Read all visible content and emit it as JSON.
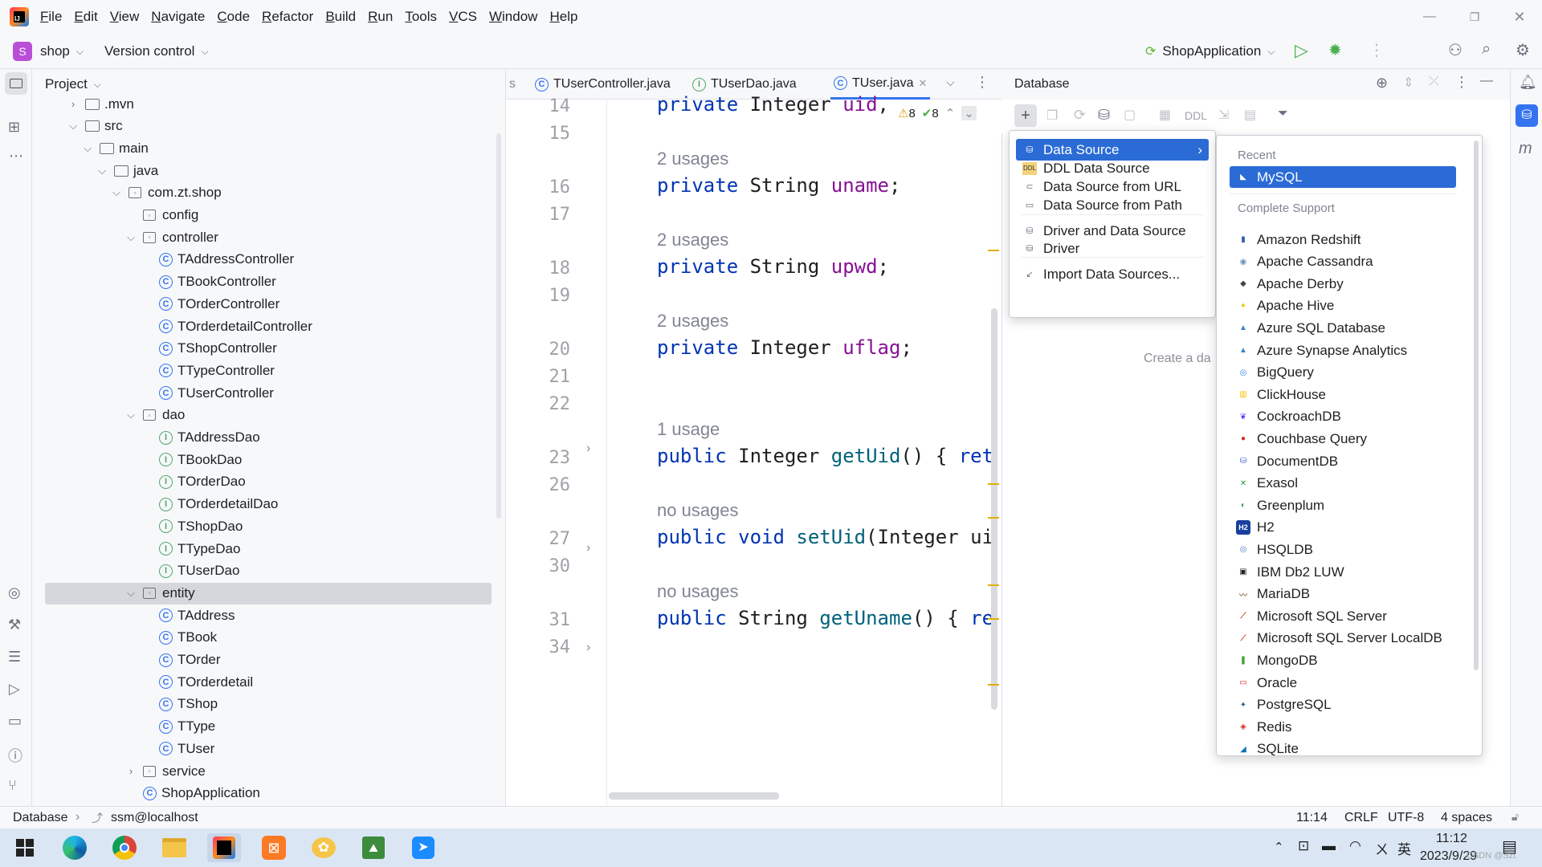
{
  "menubar": {
    "items": [
      "File",
      "Edit",
      "View",
      "Navigate",
      "Code",
      "Refactor",
      "Build",
      "Run",
      "Tools",
      "VCS",
      "Window",
      "Help"
    ]
  },
  "toolbar": {
    "project_badge": "S",
    "project_name": "shop",
    "vcs_label": "Version control",
    "run_config": "ShopApplication"
  },
  "project": {
    "title": "Project",
    "tree": [
      {
        "label": ".mvn",
        "kind": "folder",
        "depth": 1,
        "arrow": "right"
      },
      {
        "label": "src",
        "kind": "folder",
        "depth": 1,
        "arrow": "down"
      },
      {
        "label": "main",
        "kind": "folder",
        "depth": 2,
        "arrow": "down"
      },
      {
        "label": "java",
        "kind": "folder",
        "depth": 3,
        "arrow": "down"
      },
      {
        "label": "com.zt.shop",
        "kind": "package",
        "depth": 4,
        "arrow": "down"
      },
      {
        "label": "config",
        "kind": "package",
        "depth": 5,
        "arrow": ""
      },
      {
        "label": "controller",
        "kind": "package",
        "depth": 5,
        "arrow": "down"
      },
      {
        "label": "TAddressController",
        "kind": "class",
        "depth": 6,
        "arrow": ""
      },
      {
        "label": "TBookController",
        "kind": "class",
        "depth": 6,
        "arrow": ""
      },
      {
        "label": "TOrderController",
        "kind": "class",
        "depth": 6,
        "arrow": ""
      },
      {
        "label": "TOrderdetailController",
        "kind": "class",
        "depth": 6,
        "arrow": ""
      },
      {
        "label": "TShopController",
        "kind": "class",
        "depth": 6,
        "arrow": ""
      },
      {
        "label": "TTypeController",
        "kind": "class",
        "depth": 6,
        "arrow": ""
      },
      {
        "label": "TUserController",
        "kind": "class",
        "depth": 6,
        "arrow": ""
      },
      {
        "label": "dao",
        "kind": "package",
        "depth": 5,
        "arrow": "down"
      },
      {
        "label": "TAddressDao",
        "kind": "interface",
        "depth": 6,
        "arrow": ""
      },
      {
        "label": "TBookDao",
        "kind": "interface",
        "depth": 6,
        "arrow": ""
      },
      {
        "label": "TOrderDao",
        "kind": "interface",
        "depth": 6,
        "arrow": ""
      },
      {
        "label": "TOrderdetailDao",
        "kind": "interface",
        "depth": 6,
        "arrow": ""
      },
      {
        "label": "TShopDao",
        "kind": "interface",
        "depth": 6,
        "arrow": ""
      },
      {
        "label": "TTypeDao",
        "kind": "interface",
        "depth": 6,
        "arrow": ""
      },
      {
        "label": "TUserDao",
        "kind": "interface",
        "depth": 6,
        "arrow": ""
      },
      {
        "label": "entity",
        "kind": "package",
        "depth": 5,
        "arrow": "down",
        "selected": true
      },
      {
        "label": "TAddress",
        "kind": "class",
        "depth": 6,
        "arrow": ""
      },
      {
        "label": "TBook",
        "kind": "class",
        "depth": 6,
        "arrow": ""
      },
      {
        "label": "TOrder",
        "kind": "class",
        "depth": 6,
        "arrow": ""
      },
      {
        "label": "TOrderdetail",
        "kind": "class",
        "depth": 6,
        "arrow": ""
      },
      {
        "label": "TShop",
        "kind": "class",
        "depth": 6,
        "arrow": ""
      },
      {
        "label": "TType",
        "kind": "class",
        "depth": 6,
        "arrow": ""
      },
      {
        "label": "TUser",
        "kind": "class",
        "depth": 6,
        "arrow": ""
      },
      {
        "label": "service",
        "kind": "package",
        "depth": 5,
        "arrow": "right"
      },
      {
        "label": "ShopApplication",
        "kind": "app",
        "depth": 5,
        "arrow": ""
      }
    ]
  },
  "editor": {
    "tab_partial": "s",
    "tabs": [
      "TUserController.java",
      "TUserDao.java",
      "TUser.java"
    ],
    "active_tab": "TUser.java",
    "warnings": "8",
    "checks": "8",
    "lines": [
      {
        "num": "14",
        "usage": "",
        "tokens": [
          [
            "kw",
            "private "
          ],
          [
            "",
            "Integer "
          ],
          [
            "fld",
            "uid"
          ],
          [
            "",
            ","
          ]
        ]
      },
      {
        "num": "15",
        "usage": "",
        "tokens": []
      },
      {
        "num": "16",
        "usage": "2 usages",
        "tokens": [
          [
            "kw",
            "private "
          ],
          [
            "",
            "String "
          ],
          [
            "fld",
            "uname"
          ],
          [
            "",
            ";"
          ]
        ]
      },
      {
        "num": "17",
        "usage": "",
        "tokens": []
      },
      {
        "num": "18",
        "usage": "2 usages",
        "tokens": [
          [
            "kw",
            "private "
          ],
          [
            "",
            "String "
          ],
          [
            "fld",
            "upwd"
          ],
          [
            "",
            ";"
          ]
        ]
      },
      {
        "num": "19",
        "usage": "",
        "tokens": []
      },
      {
        "num": "20",
        "usage": "2 usages",
        "tokens": [
          [
            "kw",
            "private "
          ],
          [
            "",
            "Integer "
          ],
          [
            "fld",
            "uflag"
          ],
          [
            "",
            ";"
          ]
        ]
      },
      {
        "num": "21",
        "usage": "",
        "tokens": []
      },
      {
        "num": "22",
        "usage": "",
        "tokens": []
      },
      {
        "num": "23",
        "usage": "1 usage",
        "tokens": [
          [
            "kw",
            "public "
          ],
          [
            "",
            "Integer "
          ],
          [
            "mth",
            "getUid"
          ],
          [
            "",
            "() { "
          ],
          [
            "kw",
            "ret"
          ]
        ]
      },
      {
        "num": "26",
        "usage": "",
        "tokens": []
      },
      {
        "num": "27",
        "usage": "no usages",
        "tokens": [
          [
            "kw",
            "public void "
          ],
          [
            "mth",
            "setUid"
          ],
          [
            "",
            "(Integer ui"
          ]
        ]
      },
      {
        "num": "30",
        "usage": "",
        "tokens": []
      },
      {
        "num": "31",
        "usage": "no usages",
        "tokens": [
          [
            "kw",
            "public "
          ],
          [
            "",
            "String "
          ],
          [
            "mth",
            "getUname"
          ],
          [
            "",
            "() { "
          ],
          [
            "kw",
            "re"
          ]
        ]
      },
      {
        "num": "34",
        "usage": "",
        "tokens": []
      }
    ]
  },
  "database": {
    "title": "Database",
    "toolbar_ddl": "DDL",
    "empty_hint": "Create a da",
    "new_menu": [
      {
        "label": "Data Source",
        "icon": "datasource-icon",
        "selected": true,
        "submenu": true
      },
      {
        "label": "DDL Data Source",
        "icon": "ddl-icon"
      },
      {
        "label": "Data Source from URL",
        "icon": "url-icon"
      },
      {
        "label": "Data Source from Path",
        "icon": "folder-icon"
      },
      {
        "label": "Driver and Data Source",
        "icon": "driver-icon",
        "separator_before": true
      },
      {
        "label": "Driver",
        "icon": "driver-icon"
      },
      {
        "label": "Import Data Sources...",
        "icon": "import-icon",
        "separator_before": true
      }
    ],
    "submenu": {
      "recent_header": "Recent",
      "recent": [
        {
          "label": "MySQL",
          "icon": "mysql-icon",
          "color": "#ffffff"
        }
      ],
      "complete_header": "Complete Support",
      "items": [
        {
          "label": "Amazon Redshift",
          "color": "#2f5fa8"
        },
        {
          "label": "Apache Cassandra",
          "color": "#6b8fbf"
        },
        {
          "label": "Apache Derby",
          "color": "#444444"
        },
        {
          "label": "Apache Hive",
          "color": "#e6c600"
        },
        {
          "label": "Azure SQL Database",
          "color": "#3b82c4"
        },
        {
          "label": "Azure Synapse Analytics",
          "color": "#3b82c4"
        },
        {
          "label": "BigQuery",
          "color": "#4285f4"
        },
        {
          "label": "ClickHouse",
          "color": "#f5c400"
        },
        {
          "label": "CockroachDB",
          "color": "#6933ff"
        },
        {
          "label": "Couchbase Query",
          "color": "#e02424"
        },
        {
          "label": "DocumentDB",
          "color": "#3b5fbf"
        },
        {
          "label": "Exasol",
          "color": "#2b9a3c"
        },
        {
          "label": "Greenplum",
          "color": "#2e9c4a"
        },
        {
          "label": "H2",
          "color": "#1a3fa0"
        },
        {
          "label": "HSQLDB",
          "color": "#4a7fc1"
        },
        {
          "label": "IBM Db2 LUW",
          "color": "#222222"
        },
        {
          "label": "MariaDB",
          "color": "#9a7a55"
        },
        {
          "label": "Microsoft SQL Server",
          "color": "#cc4b2e"
        },
        {
          "label": "Microsoft SQL Server LocalDB",
          "color": "#cc4b2e"
        },
        {
          "label": "MongoDB",
          "color": "#3fa037"
        },
        {
          "label": "Oracle",
          "color": "#d3231e"
        },
        {
          "label": "PostgreSQL",
          "color": "#336791"
        },
        {
          "label": "Redis",
          "color": "#d82c20"
        },
        {
          "label": "SQLite",
          "color": "#0f6fb6"
        }
      ]
    }
  },
  "status": {
    "crumb1": "Database",
    "crumb2": "ssm@localhost",
    "position": "11:14",
    "line_sep": "CRLF",
    "encoding": "UTF-8",
    "indent": "4 spaces"
  },
  "taskbar": {
    "time": "11:12",
    "date": "2023/9/29",
    "ime": "英",
    "ime2": "ㄨ",
    "watermark": "CSDN @Szt"
  }
}
